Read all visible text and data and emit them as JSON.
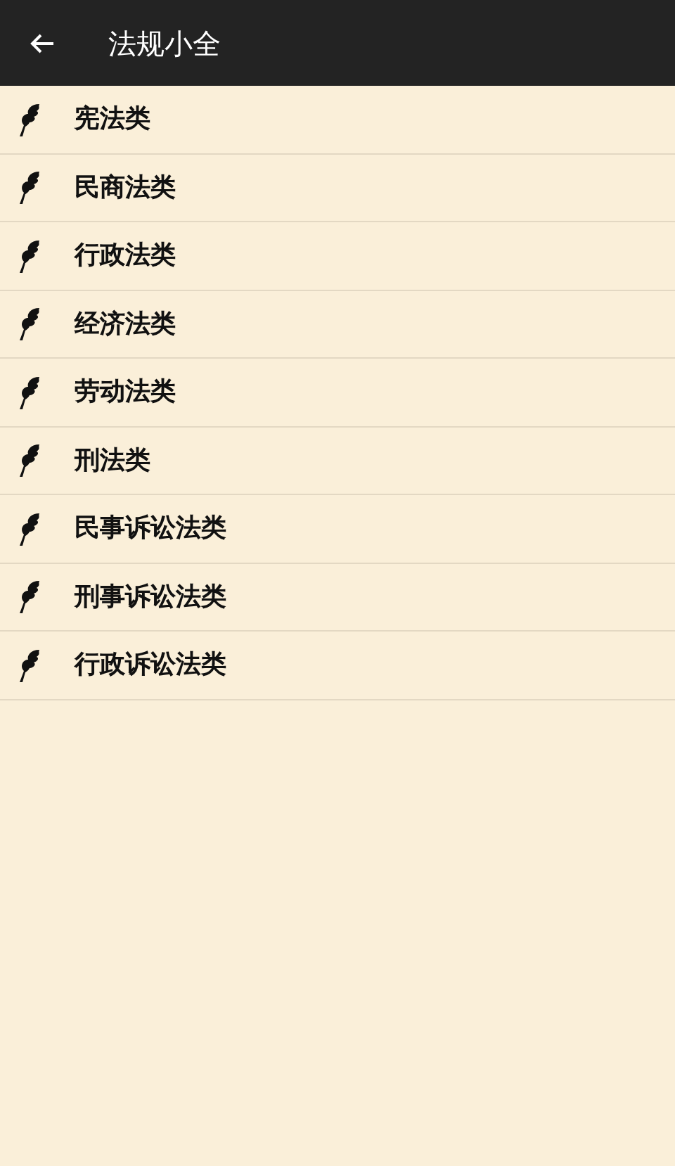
{
  "app_bar": {
    "title": "法规小全"
  },
  "items": [
    {
      "label": "宪法类"
    },
    {
      "label": "民商法类"
    },
    {
      "label": "行政法类"
    },
    {
      "label": "经济法类"
    },
    {
      "label": "劳动法类"
    },
    {
      "label": "刑法类"
    },
    {
      "label": "民事诉讼法类"
    },
    {
      "label": "刑事诉讼法类"
    },
    {
      "label": "行政诉讼法类"
    }
  ]
}
